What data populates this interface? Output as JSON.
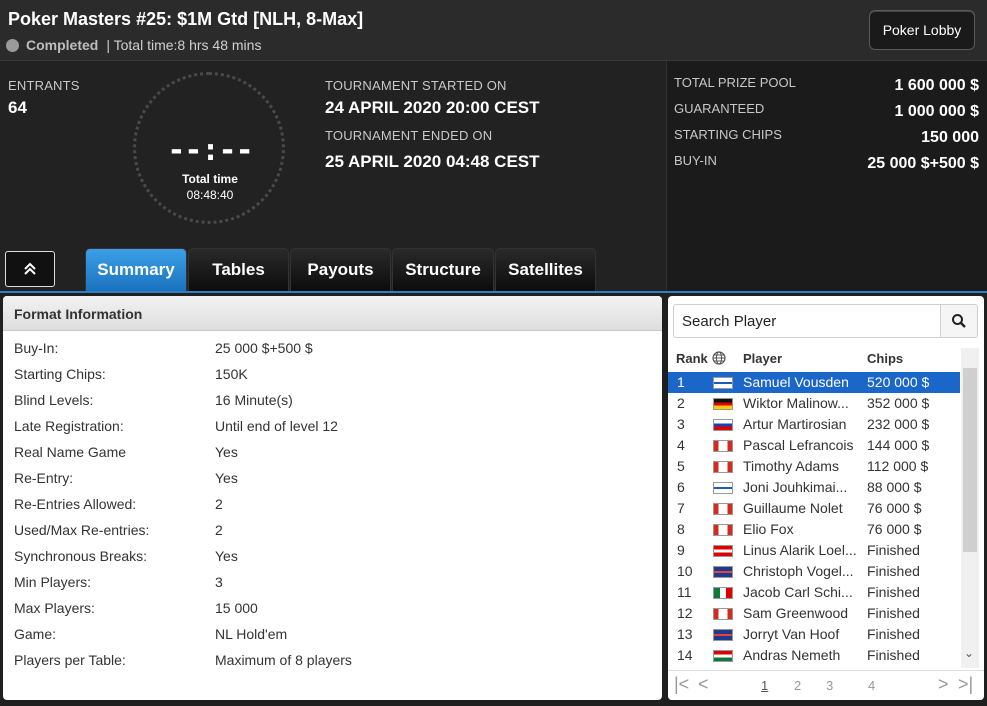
{
  "header": {
    "title": "Poker Masters #25: $1M Gtd [NLH, 8-Max]",
    "status": "Completed",
    "total_time": "| Total time:8 hrs  48 mins",
    "lobby_button": "Poker Lobby"
  },
  "info": {
    "entrants_label": "ENTRANTS",
    "entrants_value": "64",
    "clock_digits": "--:--",
    "clock_label": "Total time",
    "clock_value": "08:48:40",
    "started_label": "TOURNAMENT STARTED ON",
    "started_value": "24 APRIL 2020  20:00 CEST",
    "ended_label": "TOURNAMENT ENDED ON",
    "ended_value": "25 APRIL 2020  04:48 CEST"
  },
  "prize": {
    "pool_label": "TOTAL PRIZE POOL",
    "pool_value": "1 600 000 $",
    "guaranteed_label": "GUARANTEED",
    "guaranteed_value": "1 000 000 $",
    "chips_label": "STARTING CHIPS",
    "chips_value": "150 000",
    "buyin_label": "BUY-IN",
    "buyin_value": "25 000 $+500 $"
  },
  "tabs": [
    "Summary",
    "Tables",
    "Payouts",
    "Structure",
    "Satellites"
  ],
  "collapse_icon": "chevron-up-double-icon",
  "format": {
    "title": "Format Information",
    "rows": [
      {
        "label": "Buy-In:",
        "value": "25 000 $+500 $"
      },
      {
        "label": "Starting Chips:",
        "value": "150K"
      },
      {
        "label": "Blind Levels:",
        "value": "16 Minute(s)"
      },
      {
        "label": "Late Registration:",
        "value": "Until end of level 12"
      },
      {
        "label": "Real Name Game",
        "value": "Yes"
      },
      {
        "label": "Re-Entry:",
        "value": "Yes"
      },
      {
        "label": "Re-Entries Allowed:",
        "value": "2"
      },
      {
        "label": "Used/Max Re-entries:",
        "value": "2"
      },
      {
        "label": "Synchronous Breaks:",
        "value": "Yes"
      },
      {
        "label": "Min Players:",
        "value": "3"
      },
      {
        "label": "Max Players:",
        "value": "15 000"
      },
      {
        "label": "Game:",
        "value": "NL Hold'em"
      },
      {
        "label": "Players per Table:",
        "value": "Maximum of 8 players"
      }
    ]
  },
  "players": {
    "search_placeholder": "Search Player",
    "columns": {
      "rank": "Rank",
      "player": "Player",
      "chips": "Chips"
    },
    "rows": [
      {
        "rank": "1",
        "name": "Samuel Vousden",
        "chips": "520 000 $",
        "flag": "fi"
      },
      {
        "rank": "2",
        "name": "Wiktor Malinow...",
        "chips": "352 000 $",
        "flag": "de"
      },
      {
        "rank": "3",
        "name": "Artur Martirosian",
        "chips": "232 000 $",
        "flag": "ru"
      },
      {
        "rank": "4",
        "name": "Pascal Lefrancois",
        "chips": "144 000 $",
        "flag": "ca"
      },
      {
        "rank": "5",
        "name": "Timothy Adams",
        "chips": "112 000 $",
        "flag": "ca"
      },
      {
        "rank": "6",
        "name": "Joni Jouhkimai...",
        "chips": "88 000 $",
        "flag": "fi"
      },
      {
        "rank": "7",
        "name": "Guillaume Nolet",
        "chips": "76 000 $",
        "flag": "ca"
      },
      {
        "rank": "8",
        "name": "Elio Fox",
        "chips": "76 000 $",
        "flag": "ca"
      },
      {
        "rank": "9",
        "name": "Linus Alarik Loel...",
        "chips": "Finished",
        "flag": "at"
      },
      {
        "rank": "10",
        "name": "Christoph Vogel...",
        "chips": "Finished",
        "flag": "gb"
      },
      {
        "rank": "11",
        "name": "Jacob Carl Schi...",
        "chips": "Finished",
        "flag": "mx"
      },
      {
        "rank": "12",
        "name": "Sam Greenwood",
        "chips": "Finished",
        "flag": "ca"
      },
      {
        "rank": "13",
        "name": "Jorryt Van Hoof",
        "chips": "Finished",
        "flag": "gb"
      },
      {
        "rank": "14",
        "name": "Andras Nemeth",
        "chips": "Finished",
        "flag": "hu"
      }
    ],
    "pages": [
      "1",
      "2",
      "3",
      "4"
    ],
    "current_page": "1"
  },
  "colors": {
    "accent": "#1c72bd",
    "selected_row": "#1b66c9"
  }
}
